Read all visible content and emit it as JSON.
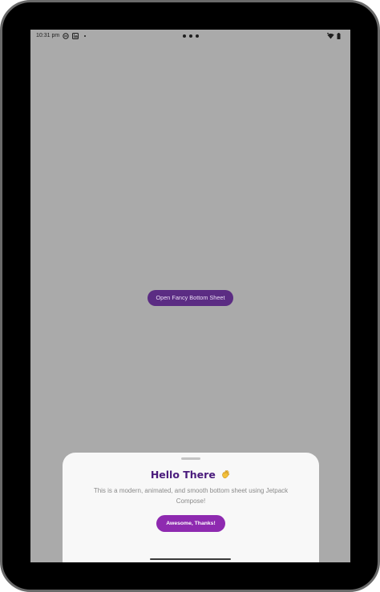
{
  "status_bar": {
    "time": "10:31 pm",
    "icons": [
      "do-not-disturb-icon",
      "linkedin-icon",
      "notification-dot-icon",
      "wifi-icon",
      "battery-icon"
    ]
  },
  "main": {
    "open_button_label": "Open Fancy Bottom Sheet"
  },
  "bottom_sheet": {
    "title": "Hello There",
    "title_emoji_icon": "waving-hand-icon",
    "body": "This is a modern, animated, and smooth bottom sheet using Jetpack Compose!",
    "action_label": "Awesome, Thanks!"
  },
  "colors": {
    "scrim": "#aaaaaa",
    "open_button_bg": "#5b2c83",
    "title": "#4a1b7c",
    "action_button_bg": "#8e2ab0",
    "sheet_bg": "#f8f8f8"
  }
}
